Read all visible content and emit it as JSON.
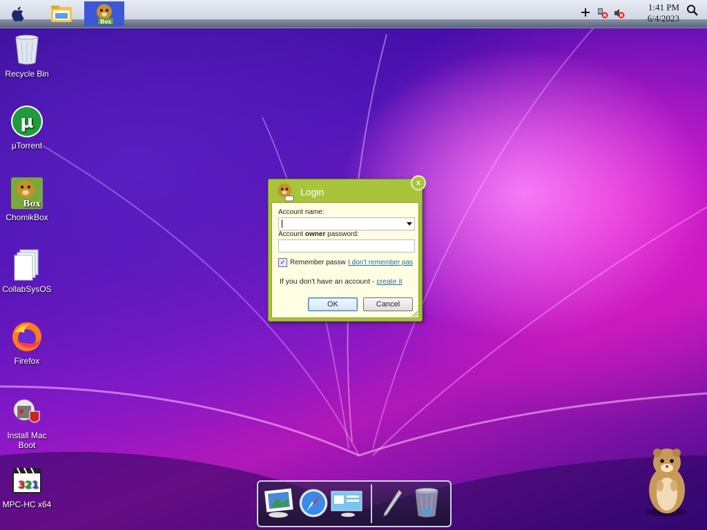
{
  "topbar": {
    "time": "1:41 PM",
    "date": "6/4/2023",
    "items": [
      {
        "icon": "apple-icon"
      },
      {
        "icon": "file-explorer-icon"
      },
      {
        "icon": "chomikbox-app-icon"
      }
    ],
    "tray": [
      "plus-icon",
      "network-disconnected-icon",
      "volume-muted-icon",
      "search-icon"
    ]
  },
  "desktop": {
    "icons": [
      {
        "label": "Recycle Bin",
        "icon": "recycle-bin-icon"
      },
      {
        "label": "µTorrent",
        "icon": "utorrent-icon"
      },
      {
        "label": "ChomikBox",
        "icon": "chomikbox-icon"
      },
      {
        "label": "CollabSysOS",
        "icon": "documents-icon"
      },
      {
        "label": "Firefox",
        "icon": "firefox-icon"
      },
      {
        "label": "Install Mac Boot",
        "icon": "installer-icon"
      },
      {
        "label": "MPC-HC x64",
        "icon": "mpc-hc-icon"
      }
    ]
  },
  "login_dialog": {
    "title": "Login",
    "close_label": "x",
    "account_name_label": "Account name:",
    "account_name_value": "",
    "password_label_prefix": "Account ",
    "password_label_bold": "owner",
    "password_label_suffix": " password:",
    "password_value": "",
    "remember_label": "Remember passw",
    "remember_checked": true,
    "forgot_link": "I don't remember pas",
    "no_account_text": "If you don't have an account - ",
    "create_link": "create it",
    "ok_label": "OK",
    "cancel_label": "Cancel"
  },
  "dock": {
    "items": [
      "preview-icon",
      "safari-icon",
      "system-info-icon",
      "pen-icon",
      "trash-icon"
    ]
  },
  "colors": {
    "dialog_green": "#a8c43a",
    "dialog_body": "#fffde2",
    "link": "#1a6fa8"
  }
}
